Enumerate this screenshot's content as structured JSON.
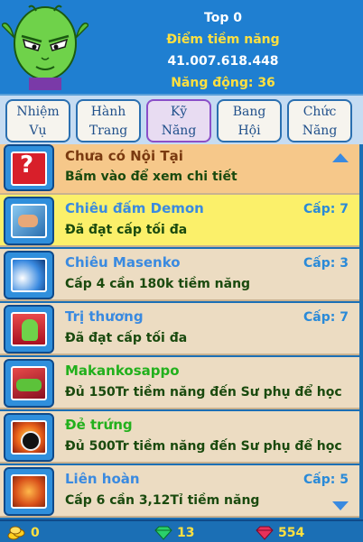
{
  "header": {
    "top_label": "Top 0",
    "potential_label": "Điểm tiềm năng",
    "potential_value": "41.007.618.448",
    "stamina_label": "Năng động: 36",
    "avatar_icon": "namekian-portrait-icon"
  },
  "tabs": [
    {
      "line1": "Nhiệm",
      "line2": "Vụ",
      "active": false
    },
    {
      "line1": "Hành",
      "line2": "Trang",
      "active": false
    },
    {
      "line1": "Kỹ",
      "line2": "Năng",
      "active": true
    },
    {
      "line1": "Bang",
      "line2": "Hội",
      "active": false
    },
    {
      "line1": "Chức",
      "line2": "Năng",
      "active": false
    }
  ],
  "skills": [
    {
      "name": "Chưa có Nội Tại",
      "desc": "Bấm vào để xem chi tiết",
      "level": "",
      "icon": "question-mark-icon"
    },
    {
      "name": "Chiêu đấm Demon",
      "desc": "Đã đạt cấp tối đa",
      "level": "Cấp: 7",
      "icon": "demon-punch-icon"
    },
    {
      "name": "Chiêu Masenko",
      "desc": "Cấp 4 cần 180k tiềm năng",
      "level": "Cấp: 3",
      "icon": "masenko-icon"
    },
    {
      "name": "Trị thương",
      "desc": "Đã đạt cấp tối đa",
      "level": "Cấp: 7",
      "icon": "heal-icon"
    },
    {
      "name": "Makankosappo",
      "desc": "Đủ 150Tr tiềm năng đến Sư phụ để học",
      "level": "",
      "icon": "makankosappo-icon"
    },
    {
      "name": "Đẻ trứng",
      "desc": "Đủ 500Tr tiềm năng đến Sư phụ để học",
      "level": "",
      "icon": "egg-icon"
    },
    {
      "name": "Liên hoàn",
      "desc": "Cấp 6 cần 3,12Tỉ tiềm năng",
      "level": "Cấp: 5",
      "icon": "combo-icon"
    }
  ],
  "footer": {
    "gold": "0",
    "gems": "13",
    "rubies": "554"
  },
  "colors": {
    "header_bg": "#1f7fd1",
    "selected_row": "#fbf06a",
    "first_row": "#f6c88a",
    "row_bg": "#ecdcc2",
    "accent_yellow": "#ffe040"
  }
}
